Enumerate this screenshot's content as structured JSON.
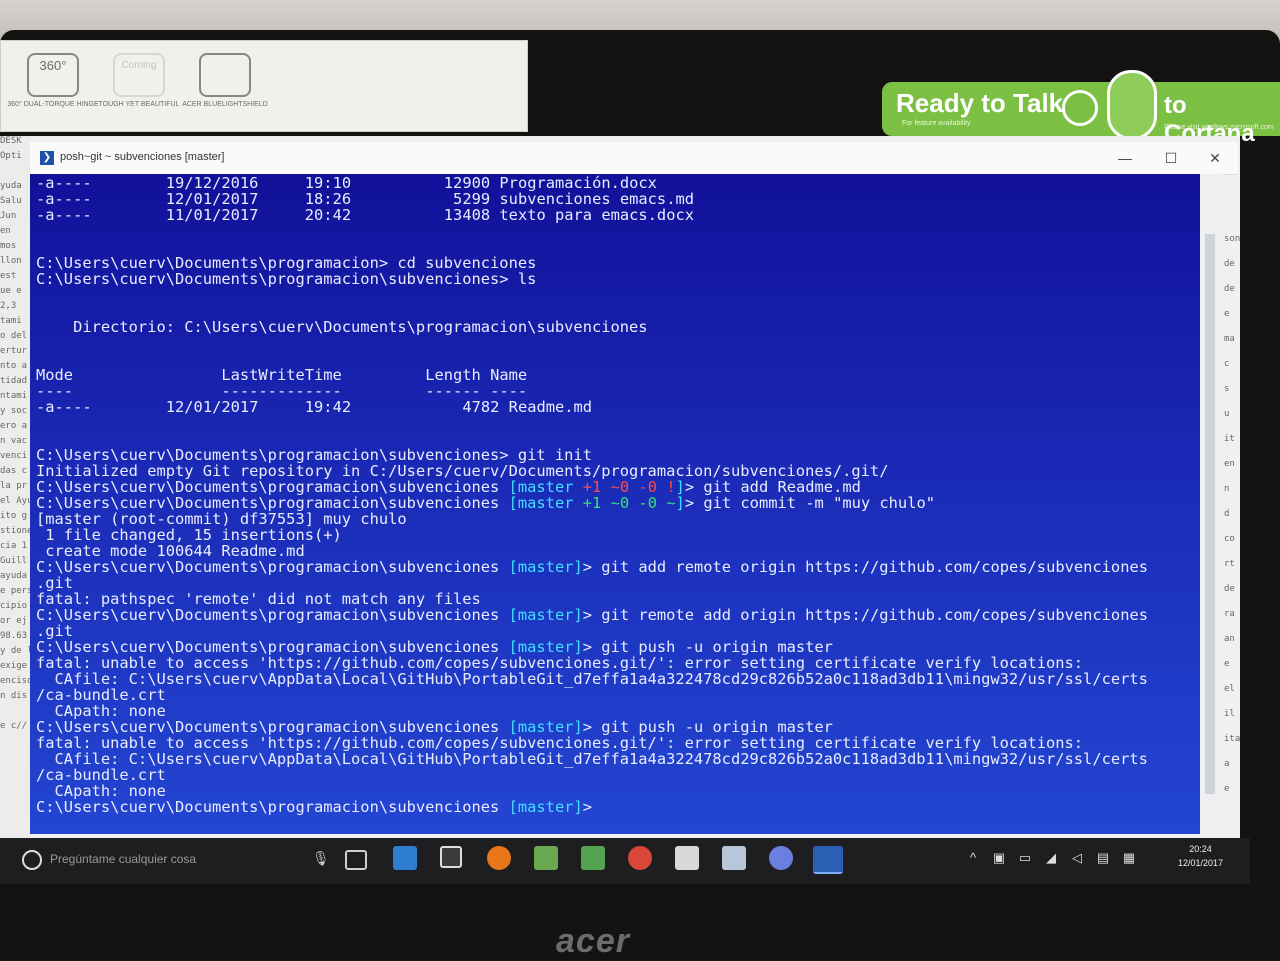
{
  "sticker": {
    "items": [
      {
        "big": "360°",
        "caption": "360° DUAL-TORQUE HINGE"
      },
      {
        "big": "Corning",
        "caption": "TOUGH YET BEAUTIFUL"
      },
      {
        "big": "",
        "caption": "ACER BLUELIGHTSHIELD"
      }
    ]
  },
  "cortana": {
    "ready": "Ready to Talk",
    "ready_sub": "For feature availability",
    "to": "to Cortana",
    "to_sub": "Please visit windows.microsoft.com"
  },
  "desk_strip": [
    "DESK",
    "Opti",
    "",
    "yuda",
    "Salu",
    "Jun",
    "en",
    "mos",
    "llon",
    "est",
    "ue e",
    "2,3",
    "tami",
    "o del",
    "ertur",
    "nto a",
    "tidad",
    "ntami",
    "y soc",
    "ero a",
    "n vac",
    "venci",
    "das c",
    "la pr",
    "el Ayu",
    "ito g",
    "stione",
    "cia 1",
    "Guill",
    "ayuda",
    "e pers",
    "cipio",
    "or ej",
    "98.63",
    "y de l",
    "exige",
    "enciso",
    "n dis",
    "",
    "e c//"
  ],
  "right_strip": [
    "son",
    "de",
    "de",
    "e",
    "ma",
    "c",
    "s",
    "u",
    "it",
    "en",
    "n",
    "d",
    "co",
    "rt",
    "de",
    "ra",
    "an",
    "e",
    "el",
    "il",
    "ita",
    "a",
    "e"
  ],
  "window": {
    "title": "posh~git ~ subvenciones [master]",
    "minimize": "—",
    "maximize": "☐",
    "close": "✕"
  },
  "console": {
    "l1": {
      "mode": "-a----",
      "date": "19/12/2016",
      "time": "19:10",
      "len": "12900",
      "name": "Programación.docx"
    },
    "l2": {
      "mode": "-a----",
      "date": "12/01/2017",
      "time": "18:26",
      "len": "5299",
      "name": "subvenciones emacs.md"
    },
    "l3": {
      "mode": "-a----",
      "date": "11/01/2017",
      "time": "20:42",
      "len": "13408",
      "name": "texto para emacs.docx"
    },
    "cmd_cd": "C:\\Users\\cuerv\\Documents\\programacion> cd subvenciones",
    "cmd_ls": "C:\\Users\\cuerv\\Documents\\programacion\\subvenciones> ls",
    "directorio": "    Directorio: C:\\Users\\cuerv\\Documents\\programacion\\subvenciones",
    "hdr_mode": "Mode",
    "hdr_lwt": "LastWriteTime",
    "hdr_length": "Length",
    "hdr_name": "Name",
    "sep_mode": "----",
    "sep_lwt": "-------------",
    "sep_length": "------",
    "sep_name": "----",
    "row_mode": "-a----",
    "row_date": "12/01/2017",
    "row_time": "19:42",
    "row_len": "4782",
    "row_name": "Readme.md",
    "cmd_init": "C:\\Users\\cuerv\\Documents\\programacion\\subvenciones> git init",
    "init_out": "Initialized empty Git repository in C:/Users/cuerv/Documents/programacion/subvenciones/.git/",
    "p_path": "C:\\Users\\cuerv\\Documents\\programacion\\subvenciones",
    "br_open": "[",
    "br_close": "]",
    "branch": "master",
    "s1_plus": "+1",
    "s1_tilde": "~0",
    "s1_minus": "-0",
    "s1_bang": "!",
    "s2_plus": "+1",
    "s2_tilde": "~0",
    "s2_minus": "-0",
    "s2_tilde2": "~",
    "cmd_add": "> git add Readme.md",
    "cmd_commit": "> git commit -m \"muy chulo\"",
    "commit_out1": "[master (root-commit) df37553] muy chulo",
    "commit_out2": " 1 file changed, 15 insertions(+)",
    "commit_out3": " create mode 100644 Readme.md",
    "cmd_add_remote": "> git add remote origin https://github.com/copes/subvenciones",
    "wrap_git1": ".git",
    "fatal1": "fatal: pathspec 'remote' did not match any files",
    "cmd_remote_add": "> git remote add origin https://github.com/copes/subvenciones",
    "wrap_git2": ".git",
    "cmd_push": "> git push -u origin master",
    "fatal2": "fatal: unable to access 'https://github.com/copes/subvenciones.git/': error setting certificate verify locations:",
    "cafile": "  CAfile: C:\\Users\\cuerv\\AppData\\Local\\GitHub\\PortableGit_d7effa1a4a322478cd29c826b52a0c118ad3db11\\mingw32/usr/ssl/certs",
    "cabundle": "/ca-bundle.crt",
    "capath": "  CApath: none",
    "prompt_end": ">"
  },
  "taskbar": {
    "search_placeholder": "Pregúntame cualquier cosa",
    "time": "20:24",
    "date": "12/01/2017"
  },
  "brand": "acer"
}
